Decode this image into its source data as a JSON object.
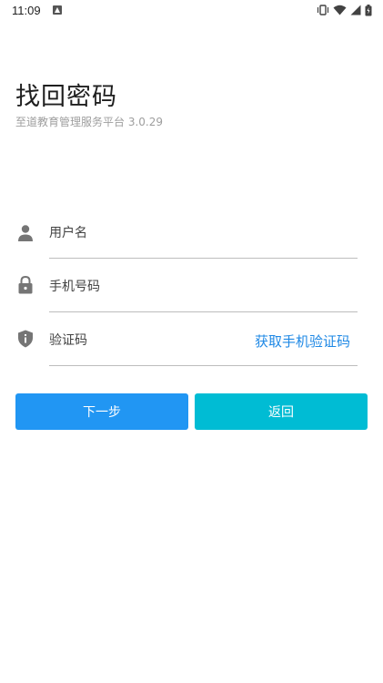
{
  "status_bar": {
    "time": "11:09"
  },
  "header": {
    "title": "找回密码",
    "subtitle": "至道教育管理服务平台 3.0.29"
  },
  "form": {
    "username_placeholder": "用户名",
    "phone_placeholder": "手机号码",
    "code_placeholder": "验证码",
    "get_code_label": "获取手机验证码"
  },
  "buttons": {
    "next_label": "下一步",
    "back_label": "返回"
  },
  "colors": {
    "primary": "#2196f3",
    "secondary": "#00bcd4",
    "link": "#1e88e5",
    "icon": "#757575"
  },
  "icons": {
    "username": "person-icon",
    "phone": "lock-icon",
    "code": "shield-icon"
  }
}
